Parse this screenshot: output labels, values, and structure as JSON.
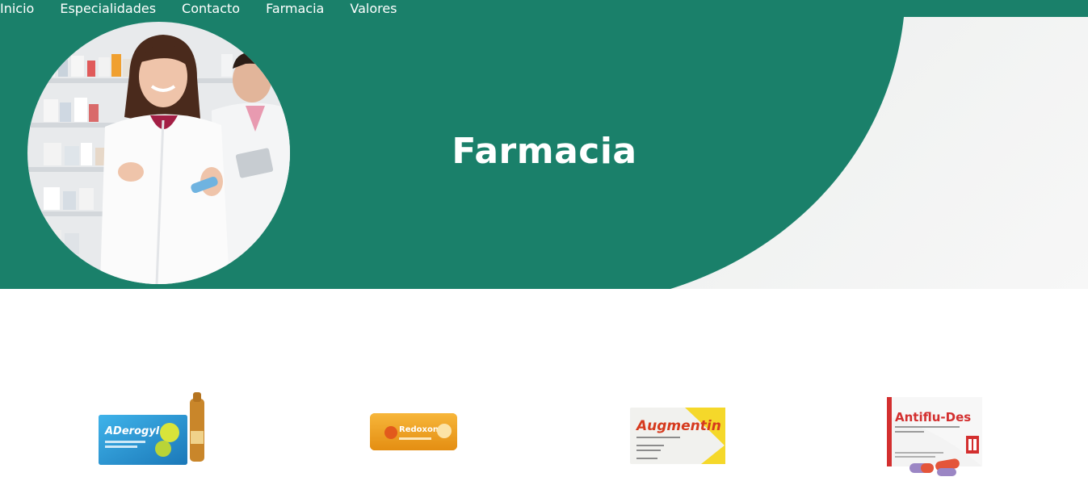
{
  "theme": {
    "accent": "#1a806a",
    "hero_bg": "#f2f3f2"
  },
  "nav": {
    "items": [
      {
        "label": "Inicio"
      },
      {
        "label": "Especialidades"
      },
      {
        "label": "Contacto"
      },
      {
        "label": "Farmacia"
      },
      {
        "label": "Valores"
      }
    ]
  },
  "hero": {
    "title": "Farmacia",
    "image": "pharmacists-photo"
  },
  "products": [
    {
      "name": "Aderogyl",
      "label": "ADerogyl",
      "icon": "aderogyl-box-image"
    },
    {
      "name": "Redoxon",
      "label": "Redoxon",
      "icon": "redoxon-tube-image"
    },
    {
      "name": "Augmentin",
      "label": "Augmentin",
      "icon": "augmentin-box-image"
    },
    {
      "name": "Antiflu-Des",
      "label": "Antiflu-Des",
      "icon": "antiflu-des-box-image"
    }
  ]
}
